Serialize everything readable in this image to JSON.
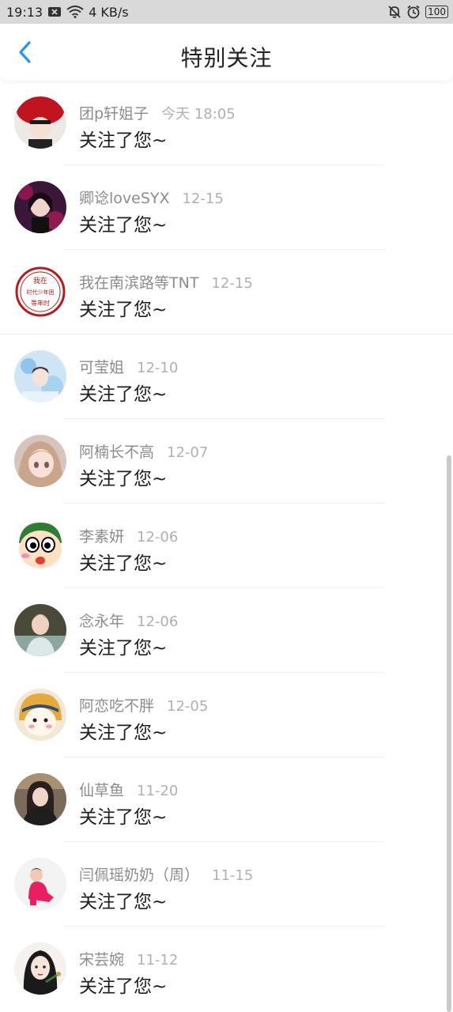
{
  "status": {
    "time": "19:13",
    "speed": "4 KB/s",
    "battery": "100",
    "icons": [
      "notification-x-icon",
      "wifi-icon",
      "mute-bell-icon",
      "alarm-icon",
      "battery-icon"
    ]
  },
  "header": {
    "back_icon": "chevron-left-icon",
    "title": "特别关注"
  },
  "colors": {
    "accent": "#2196F3",
    "name_text": "#8c8c8c",
    "date_text": "#b0b0b0",
    "message_text": "#1e1e1e"
  },
  "items": [
    {
      "name": "团p轩姐子",
      "date": "今天 18:05",
      "message": "关注了您~"
    },
    {
      "name": "卿谂loveSYX",
      "date": "12-15",
      "message": "关注了您~"
    },
    {
      "name": "我在南滨路等TNT",
      "date": "12-15",
      "message": "关注了您~"
    },
    {
      "name": "可莹姐",
      "date": "12-10",
      "message": "关注了您~"
    },
    {
      "name": "阿楠长不高",
      "date": "12-07",
      "message": "关注了您~"
    },
    {
      "name": "李素妍",
      "date": "12-06",
      "message": "关注了您~"
    },
    {
      "name": "念永年",
      "date": "12-06",
      "message": "关注了您~"
    },
    {
      "name": "阿恋吃不胖",
      "date": "12-05",
      "message": "关注了您~"
    },
    {
      "name": "仙草鱼",
      "date": "11-20",
      "message": "关注了您~"
    },
    {
      "name": "闫佩瑶奶奶（周）",
      "date": "11-15",
      "message": "关注了您~"
    },
    {
      "name": "宋芸婉",
      "date": "11-12",
      "message": "关注了您~"
    }
  ],
  "avatar_texts": {
    "stamp": "我在 时代少年团 等年时"
  }
}
